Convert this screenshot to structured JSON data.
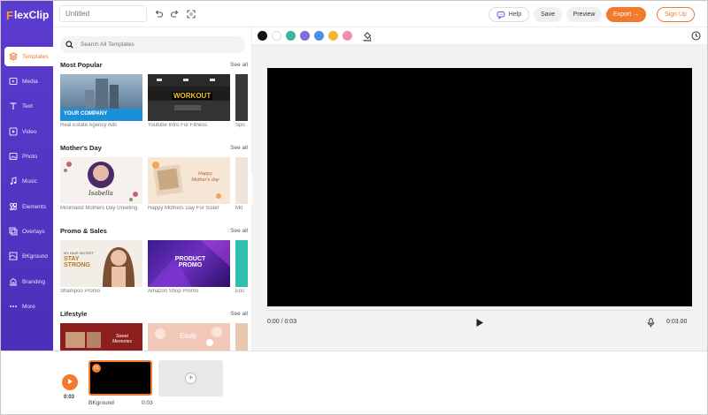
{
  "app": {
    "logo_f": "F",
    "logo_rest": "lexClip"
  },
  "topbar": {
    "title_placeholder": "Untitled",
    "help_label": "Help",
    "save_label": "Save",
    "preview_label": "Preview",
    "export_label": "Export →",
    "signup_label": "Sign Up"
  },
  "nav": {
    "items": [
      {
        "label": "Templates",
        "icon": "layers-icon"
      },
      {
        "label": "Media",
        "icon": "media-icon"
      },
      {
        "label": "Text",
        "icon": "text-icon"
      },
      {
        "label": "Video",
        "icon": "video-icon"
      },
      {
        "label": "Photo",
        "icon": "photo-icon"
      },
      {
        "label": "Music",
        "icon": "music-icon"
      },
      {
        "label": "Elements",
        "icon": "elements-icon"
      },
      {
        "label": "Overlays",
        "icon": "overlays-icon"
      },
      {
        "label": "BKground",
        "icon": "background-icon"
      },
      {
        "label": "Branding",
        "icon": "branding-icon"
      },
      {
        "label": "More",
        "icon": "more-icon"
      }
    ]
  },
  "search": {
    "placeholder": "Search All Templates"
  },
  "sections": [
    {
      "title": "Most Popular",
      "see_all": "See all",
      "items": [
        {
          "caption": "Real Estate Agency Ads",
          "thumb_text": "YOUR COMPANY"
        },
        {
          "caption": "Youtube Intro For Fitness",
          "thumb_text": "WORKOUT"
        },
        {
          "caption": "Spo"
        }
      ]
    },
    {
      "title": "Mother's Day",
      "see_all": "See all",
      "items": [
        {
          "caption": "Minimalist Mothers Day Greeting",
          "thumb_text": "Isabella"
        },
        {
          "caption": "Happy Mothers Day For Sister",
          "thumb_text": "Happy Mother's day"
        },
        {
          "caption": "Mo"
        }
      ]
    },
    {
      "title": "Promo & Sales",
      "see_all": "See all",
      "items": [
        {
          "caption": "Shampoo Promo",
          "thumb_text": "STAY STRONG",
          "thumb_sub": "MY HAIR SECRET"
        },
        {
          "caption": "Amazon Shop Promo",
          "thumb_text": "PRODUCT PROMO"
        },
        {
          "caption": "Enc"
        }
      ]
    },
    {
      "title": "Lifestyle",
      "see_all": "See all",
      "items": [
        {
          "thumb_text": "Sweet Memories"
        },
        {
          "thumb_text": "Emily"
        },
        {}
      ]
    }
  ],
  "colors": {
    "swatches": [
      "#111111",
      "#ffffff",
      "#3bb5a0",
      "#7b6fd8",
      "#4a90e2",
      "#f2b730",
      "#f08fb0"
    ],
    "accent": "#f07a2e",
    "nav_bg": "#5b3ccf"
  },
  "player": {
    "current_time": "0:00 / 0:03",
    "duration": "0:03.00"
  },
  "timeline": {
    "time": "0:03",
    "scene_number": "01",
    "scene_label": "BKground",
    "scene_duration": "0:03"
  }
}
